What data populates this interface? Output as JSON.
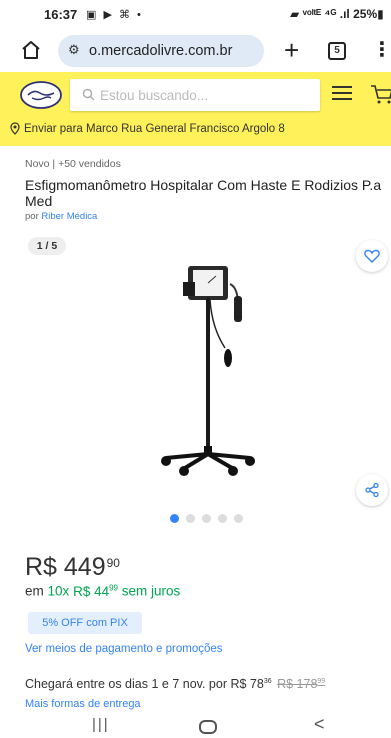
{
  "status_bar": {
    "time": "16:37",
    "left_icons": "▣ ▶ ⌘ •",
    "right_text": "▰ ᵛᵒˡᵗᴱ ⁴ᴳ .ıl 25%▮"
  },
  "browser": {
    "url": "o.mercadolivre.com.br",
    "tab_count": "5"
  },
  "header": {
    "search_placeholder": "Estou buscando...",
    "location": "Enviar para Marco Rua General Francisco Argolo 8"
  },
  "product": {
    "meta": "Novo  |  +50 vendidos",
    "title": "Esfigmomanômetro Hospitalar Com Haste E Rodizios P.a Med",
    "seller_prefix": "por",
    "seller_name": "Riber Médica",
    "image_counter": "1 / 5",
    "carousel": {
      "count": 5,
      "active": 0
    },
    "price_whole": "R$ 449",
    "price_cents": "90",
    "installments_prefix": "em",
    "installments_count": "10x",
    "installments_whole": "R$ 44",
    "installments_cents": "99",
    "installments_suffix": "sem juros",
    "pix_badge": "5% OFF com PIX",
    "payment_link": "Ver meios de pagamento e promoções",
    "delivery_text": "Chegará entre os dias 1 e 7 nov. por R$ 78",
    "delivery_cents": "36",
    "delivery_old_whole": "R$ 178",
    "delivery_old_cents": "99",
    "shipping_link": "Mais formas de entrega"
  },
  "colors": {
    "header_bg": "#fff159",
    "link_blue": "#3483fa",
    "green": "#00a650"
  },
  "nav": {
    "recents": "|||",
    "back": "<"
  }
}
